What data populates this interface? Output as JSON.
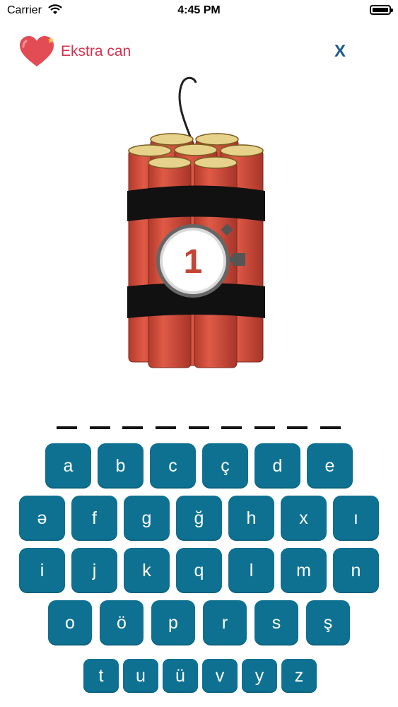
{
  "status_bar": {
    "carrier": "Carrier",
    "time": "4:45 PM"
  },
  "header": {
    "extra_life_label": "Ekstra can",
    "close_label": "X"
  },
  "bomb": {
    "timer_value": "1",
    "colors": {
      "stick": "#d64a3a",
      "band": "#111111",
      "tip": "#e6d28a"
    }
  },
  "answer": {
    "slot_count": 9
  },
  "keyboard": {
    "rows": [
      [
        "a",
        "b",
        "c",
        "ç",
        "d",
        "e"
      ],
      [
        "ə",
        "f",
        "g",
        "ğ",
        "h",
        "x",
        "ı"
      ],
      [
        "i",
        "j",
        "k",
        "q",
        "l",
        "m",
        "n"
      ],
      [
        "o",
        "ö",
        "p",
        "r",
        "s",
        "ş"
      ],
      [
        "t",
        "u",
        "ü",
        "v",
        "y",
        "z"
      ]
    ],
    "key_color": "#0e7192"
  }
}
